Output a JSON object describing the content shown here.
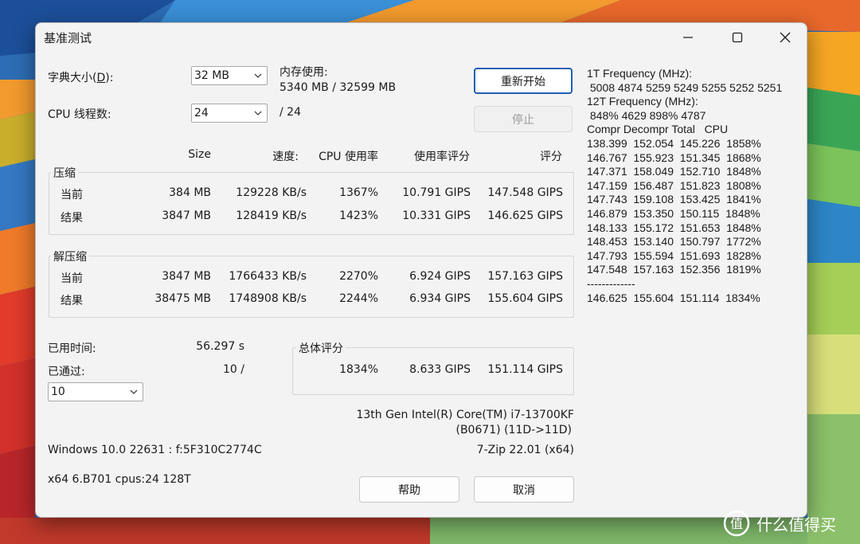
{
  "window": {
    "title": "基准测试"
  },
  "settings": {
    "dict_label": "字典大小(",
    "dict_key": "D",
    "dict_label_end": "):",
    "dict_value": "32 MB",
    "threads_label": "CPU 线程数:",
    "threads_value": "24",
    "threads_max": "/ 24",
    "memory_label": "内存使用:",
    "memory_value": "5340 MB / 32599 MB"
  },
  "buttons": {
    "restart": "重新开始",
    "stop": "停止",
    "help": "帮助",
    "cancel": "取消"
  },
  "table": {
    "headers": [
      "Size",
      "速度:",
      "CPU 使用率",
      "使用率评分",
      "评分"
    ],
    "compress": {
      "label": "压缩",
      "rows": [
        {
          "label": "当前",
          "size": "384 MB",
          "speed": "129228 KB/s",
          "cpu": "1367%",
          "usage_rating": "10.791 GIPS",
          "rating": "147.548 GIPS"
        },
        {
          "label": "结果",
          "size": "3847 MB",
          "speed": "128419 KB/s",
          "cpu": "1423%",
          "usage_rating": "10.331 GIPS",
          "rating": "146.625 GIPS"
        }
      ]
    },
    "decompress": {
      "label": "解压缩",
      "rows": [
        {
          "label": "当前",
          "size": "3847 MB",
          "speed": "1766433 KB/s",
          "cpu": "2270%",
          "usage_rating": "6.924 GIPS",
          "rating": "157.163 GIPS"
        },
        {
          "label": "结果",
          "size": "38475 MB",
          "speed": "1748908 KB/s",
          "cpu": "2244%",
          "usage_rating": "6.934 GIPS",
          "rating": "155.604 GIPS"
        }
      ]
    }
  },
  "status": {
    "elapsed_label": "已用时间:",
    "elapsed_value": "56.297 s",
    "passes_label": "已通过:",
    "passes_value": "10 /",
    "passes_select": "10"
  },
  "total": {
    "label": "总体评分",
    "cpu": "1834%",
    "usage_rating": "8.633 GIPS",
    "rating": "151.114 GIPS"
  },
  "system": {
    "cpu_name": "13th Gen Intel(R) Core(TM) i7-13700KF",
    "cpu_id": "(B0671) (11D->11D)",
    "os": "Windows 10.0 22631 :  f:5F310C2774C",
    "version": "7-Zip 22.01 (x64)",
    "arch": "x64 6.B701 cpus:24 128T"
  },
  "log": {
    "lines": [
      "1T Frequency (MHz):",
      " 5008 4874 5259 5249 5255 5252 5251",
      "12T Frequency (MHz):",
      " 848% 4629 898% 4787",
      "Compr Decompr Total   CPU",
      "138.399  152.054  145.226  1858%",
      "146.767  155.923  151.345  1868%",
      "147.371  158.049  152.710  1848%",
      "147.159  156.487  151.823  1808%",
      "147.743  159.108  153.425  1841%",
      "146.879  153.350  150.115  1848%",
      "148.133  155.172  151.653  1848%",
      "148.453  153.140  150.797  1772%",
      "147.793  155.594  151.693  1828%",
      "147.548  157.163  152.356  1819%",
      "-------------",
      "146.625  155.604  151.114  1834%"
    ]
  },
  "watermark": {
    "text": "什么值得买",
    "logo_icon": "zhi-logo-icon"
  },
  "icons": {
    "minimize": "minimize-icon",
    "maximize": "maximize-icon",
    "close": "close-icon",
    "dropdown": "chevron-down-icon"
  }
}
